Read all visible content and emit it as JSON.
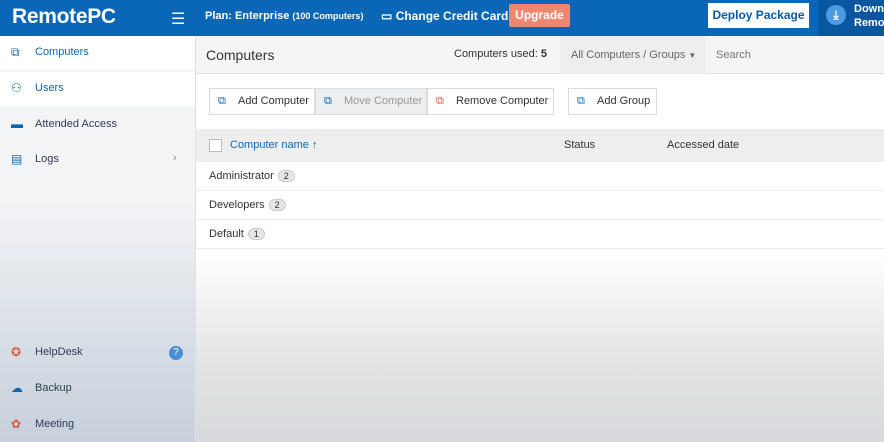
{
  "header": {
    "logo": "RemotePC",
    "plan_label": "Plan: Enterprise",
    "plan_detail": "(100 Computers)",
    "change_card": "Change Credit Card",
    "upgrade": "Upgrade",
    "deploy": "Deploy Package",
    "download_line1": "Down",
    "download_line2": "Remo"
  },
  "sidebar": {
    "items": [
      {
        "label": "Computers"
      },
      {
        "label": "Users"
      },
      {
        "label": "Attended Access"
      },
      {
        "label": "Logs"
      }
    ],
    "bottom": [
      {
        "label": "HelpDesk"
      },
      {
        "label": "Backup"
      },
      {
        "label": "Meeting"
      }
    ]
  },
  "main": {
    "title": "Computers",
    "used_label": "Computers used:",
    "used_value": "5",
    "group_select": "All Computers / Groups",
    "search_placeholder": "Search",
    "buttons": {
      "add": "Add Computer",
      "move": "Move Computer",
      "remove": "Remove Computer",
      "add_group": "Add Group"
    },
    "columns": {
      "name": "Computer name",
      "status": "Status",
      "accessed": "Accessed date"
    },
    "rows": [
      {
        "name": "Administrator",
        "count": "2"
      },
      {
        "name": "Developers",
        "count": "2"
      },
      {
        "name": "Default",
        "count": "1"
      }
    ]
  }
}
